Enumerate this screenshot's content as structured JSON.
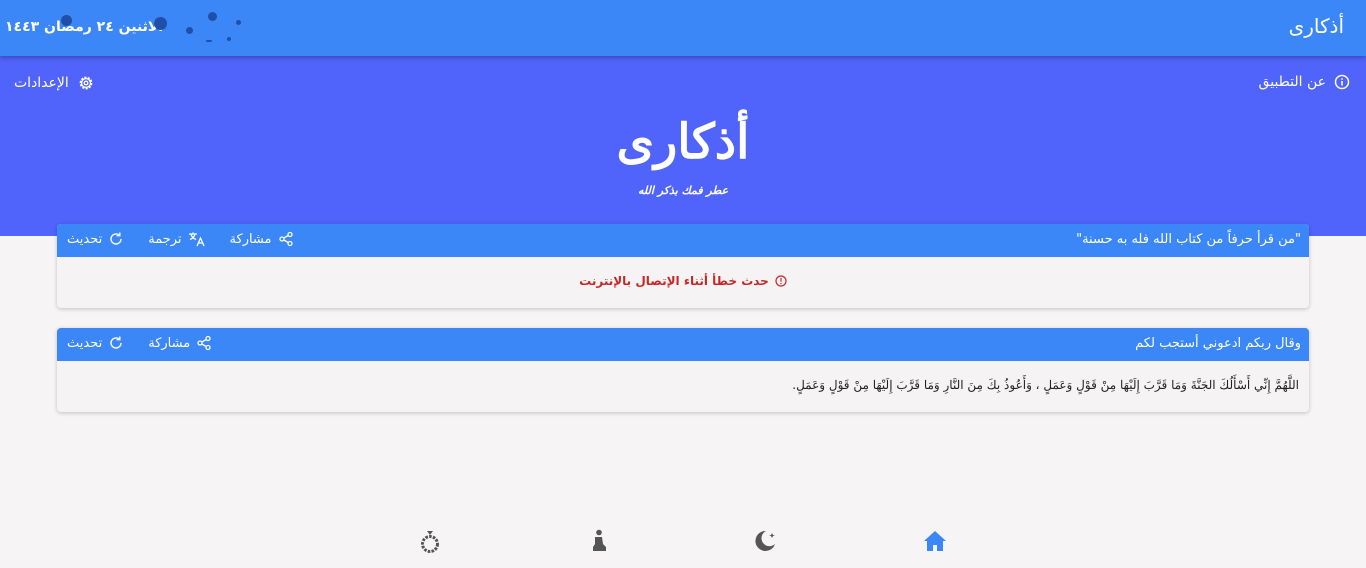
{
  "appbar": {
    "title": "أذكارى",
    "date": "الاثنين ٢٤ رمضان ١٤٤٣"
  },
  "hero": {
    "about_label": "عن التطبيق",
    "settings_label": "الإعدادات",
    "logo_text": "أذكارى",
    "tagline": "عطر فمك بذكر الله"
  },
  "quote_card": {
    "title": "\"من قرأ حرفاً من كتاب الله فله به حسنة\"",
    "share_label": "مشاركة",
    "translate_label": "ترجمة",
    "refresh_label": "تحديث",
    "error_text": "حدث خطأ أثناء الإتصال بالإنترنت"
  },
  "dua_card": {
    "title": "وقال ربكم ادعوني أستجب لكم",
    "share_label": "مشاركة",
    "refresh_label": "تحديث",
    "text": "اللَّهُمَّ إِنِّي أَسْأَلُكَ الجَنَّةَ وَمَا قَرَّبَ إِلَيْهَا مِنْ قَوْلٍ وَعَمَلٍ ، وَأَعُوذُ بِكَ مِنَ النَّارِ وَمَا قَرَّبَ إِلَيْهَا مِنْ قَوْلٍ وَعَمَلٍ."
  },
  "bottom_nav": {
    "items": [
      {
        "icon": "home-icon",
        "active": true
      },
      {
        "icon": "crescent-star-icon",
        "active": false
      },
      {
        "icon": "prayer-icon",
        "active": false
      },
      {
        "icon": "prayer-beads-icon",
        "active": false
      }
    ]
  },
  "colors": {
    "appbar": "#3b87f7",
    "hero": "#5063fb",
    "error": "#c62828",
    "nav_active": "#3b87f7",
    "nav_inactive": "#555555"
  }
}
